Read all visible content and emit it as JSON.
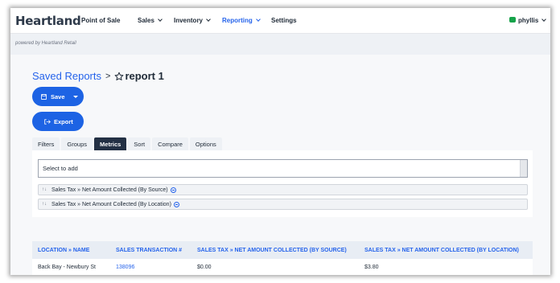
{
  "nav": {
    "brand": "Heartland",
    "items": [
      {
        "label": "Point of Sale",
        "has_menu": false,
        "active": false
      },
      {
        "label": "Sales",
        "has_menu": true,
        "active": false
      },
      {
        "label": "Inventory",
        "has_menu": true,
        "active": false
      },
      {
        "label": "Reporting",
        "has_menu": true,
        "active": true
      },
      {
        "label": "Settings",
        "has_menu": false,
        "active": false
      }
    ],
    "user": "phyllis"
  },
  "powered_by": "powered by Heartland Retail",
  "breadcrumb": {
    "parent": "Saved Reports",
    "separator": ">",
    "current": "report 1"
  },
  "buttons": {
    "save": "Save",
    "export": "Export"
  },
  "tabs": [
    {
      "label": "Filters",
      "active": false
    },
    {
      "label": "Groups",
      "active": false
    },
    {
      "label": "Metrics",
      "active": true
    },
    {
      "label": "Sort",
      "active": false
    },
    {
      "label": "Compare",
      "active": false
    },
    {
      "label": "Options",
      "active": false
    }
  ],
  "metrics_panel": {
    "select_placeholder": "Select to add",
    "selected": [
      "Sales Tax » Net Amount Collected (By Source)",
      "Sales Tax » Net Amount Collected (By Location)"
    ]
  },
  "table": {
    "headers": [
      "LOCATION » NAME",
      "SALES TRANSACTION #",
      "SALES TAX » NET AMOUNT COLLECTED (BY SOURCE)",
      "SALES TAX » NET AMOUNT COLLECTED (BY LOCATION)"
    ],
    "rows": [
      [
        "Back Bay - Newbury St",
        "138096",
        "$0.00",
        "$3.80"
      ]
    ]
  },
  "colors": {
    "accent": "#1d63e4",
    "active_tab": "#233044",
    "user_badge": "#16a34a"
  }
}
